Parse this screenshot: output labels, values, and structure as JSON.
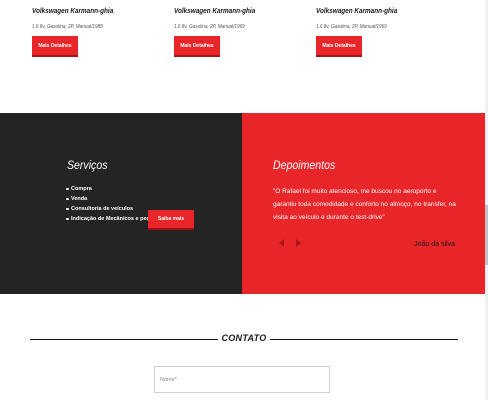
{
  "products": [
    {
      "title": "Volkswagen Karmann-ghia",
      "meta": "1.6 8v, Gasolina, 2P, Manual/1988",
      "button": "Mais Detalhes"
    },
    {
      "title": "Volkswagen Karmann-ghia",
      "meta": "1.6 8v, Gasolina, 2P, Manual/1969",
      "button": "Mais Detalhes"
    },
    {
      "title": "Volkswagen Karmann-ghia",
      "meta": "1.6 8v, Gasolina, 2P, Manual/1969",
      "button": "Mais Detalhes"
    }
  ],
  "services": {
    "heading": "Serviços",
    "items": [
      "Compra",
      "Venda",
      "Consultoria de veículos",
      "Indicação de Mecânicos e peças"
    ],
    "button": "Saiba mais"
  },
  "testimonials": {
    "heading": "Depoimentos",
    "quote": "\"O Rafael foi muito atencioso, me buscou no aeroporto e garantiu toda comodidade e conforto no almoço, no transfer, na visita ao veículo e durante o test-drive\"",
    "author": "João da silva"
  },
  "contact": {
    "title": "CONTATO",
    "name_placeholder": "Nome*"
  },
  "colors": {
    "accent": "#e8262a",
    "dark": "#242424"
  },
  "icons": {
    "prev": "triangle-left",
    "next": "triangle-right"
  }
}
